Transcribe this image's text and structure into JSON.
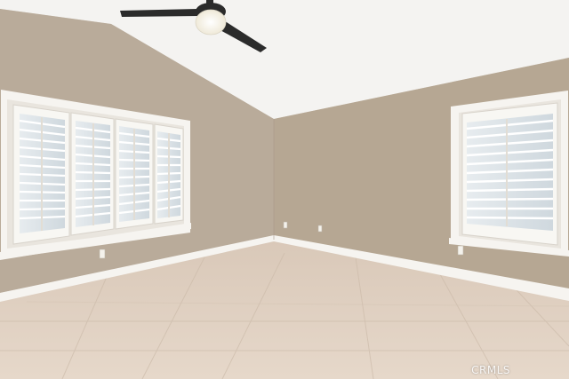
{
  "watermark": {
    "text": "CRMLS"
  },
  "colors": {
    "ceiling": "#f4f3f1",
    "left_wall": "#b9ab9a",
    "back_wall": "#b6a793",
    "right_wall": "#b4a693",
    "floor": "#ddcdbd",
    "trim": "#f6f4f0",
    "shutter": "#f8f7f3",
    "glass": "#dfe5ea",
    "fan_body": "#2b2b2b",
    "fan_light": "#fffdf4"
  },
  "icons": [
    "ceiling-fan-icon",
    "outlet-icon"
  ]
}
